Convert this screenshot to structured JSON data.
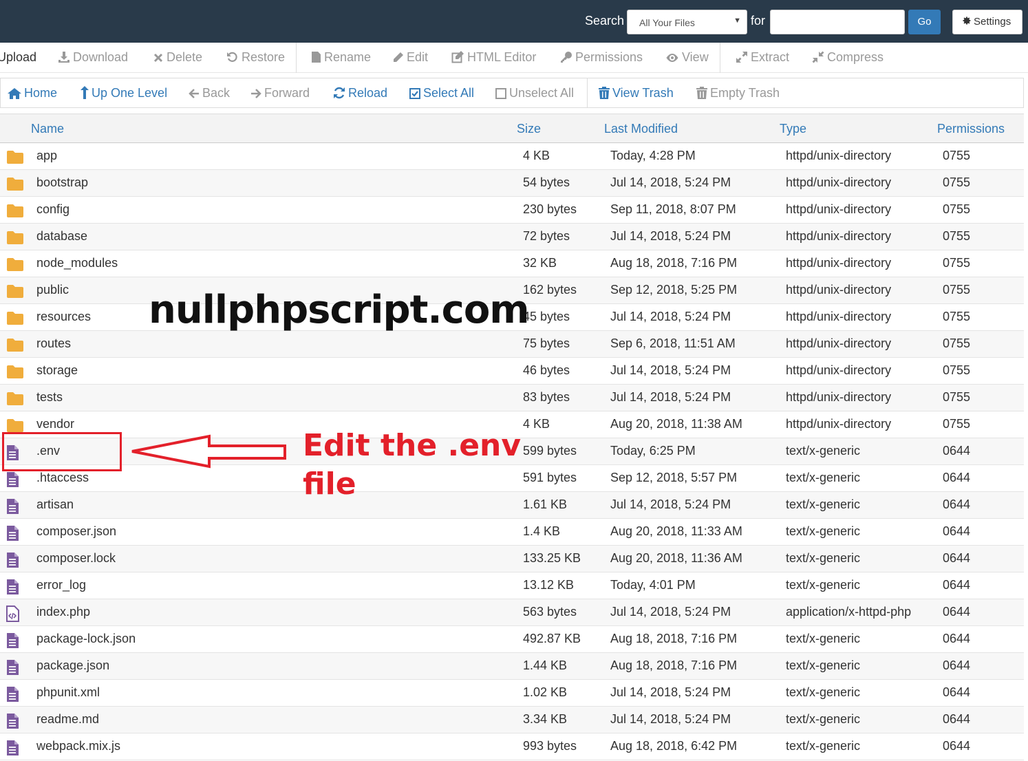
{
  "topbar": {
    "search_label": "Search",
    "scope_value": "All Your Files",
    "for_label": "for",
    "search_value": "",
    "go_label": "Go",
    "settings_label": "Settings"
  },
  "toolbar1": {
    "upload": "Upload",
    "download": "Download",
    "delete": "Delete",
    "restore": "Restore",
    "rename": "Rename",
    "edit": "Edit",
    "html_editor": "HTML Editor",
    "permissions": "Permissions",
    "view": "View",
    "extract": "Extract",
    "compress": "Compress"
  },
  "toolbar2": {
    "home": "Home",
    "up_one_level": "Up One Level",
    "back": "Back",
    "forward": "Forward",
    "reload": "Reload",
    "select_all": "Select All",
    "unselect_all": "Unselect All",
    "view_trash": "View Trash",
    "empty_trash": "Empty Trash"
  },
  "table": {
    "headers": {
      "name": "Name",
      "size": "Size",
      "last_modified": "Last Modified",
      "type": "Type",
      "permissions": "Permissions"
    },
    "rows": [
      {
        "icon": "folder-icon",
        "name": "app",
        "size": "4 KB",
        "modified": "Today, 4:28 PM",
        "type": "httpd/unix-directory",
        "perms": "0755"
      },
      {
        "icon": "folder-icon",
        "name": "bootstrap",
        "size": "54 bytes",
        "modified": "Jul 14, 2018, 5:24 PM",
        "type": "httpd/unix-directory",
        "perms": "0755"
      },
      {
        "icon": "folder-icon",
        "name": "config",
        "size": "230 bytes",
        "modified": "Sep 11, 2018, 8:07 PM",
        "type": "httpd/unix-directory",
        "perms": "0755"
      },
      {
        "icon": "folder-icon",
        "name": "database",
        "size": "72 bytes",
        "modified": "Jul 14, 2018, 5:24 PM",
        "type": "httpd/unix-directory",
        "perms": "0755"
      },
      {
        "icon": "folder-icon",
        "name": "node_modules",
        "size": "32 KB",
        "modified": "Aug 18, 2018, 7:16 PM",
        "type": "httpd/unix-directory",
        "perms": "0755"
      },
      {
        "icon": "folder-icon",
        "name": "public",
        "size": "162 bytes",
        "modified": "Sep 12, 2018, 5:25 PM",
        "type": "httpd/unix-directory",
        "perms": "0755"
      },
      {
        "icon": "folder-icon",
        "name": "resources",
        "size": "45 bytes",
        "modified": "Jul 14, 2018, 5:24 PM",
        "type": "httpd/unix-directory",
        "perms": "0755"
      },
      {
        "icon": "folder-icon",
        "name": "routes",
        "size": "75 bytes",
        "modified": "Sep 6, 2018, 11:51 AM",
        "type": "httpd/unix-directory",
        "perms": "0755"
      },
      {
        "icon": "folder-icon",
        "name": "storage",
        "size": "46 bytes",
        "modified": "Jul 14, 2018, 5:24 PM",
        "type": "httpd/unix-directory",
        "perms": "0755"
      },
      {
        "icon": "folder-icon",
        "name": "tests",
        "size": "83 bytes",
        "modified": "Jul 14, 2018, 5:24 PM",
        "type": "httpd/unix-directory",
        "perms": "0755"
      },
      {
        "icon": "folder-icon",
        "name": "vendor",
        "size": "4 KB",
        "modified": "Aug 20, 2018, 11:38 AM",
        "type": "httpd/unix-directory",
        "perms": "0755"
      },
      {
        "icon": "file-icon",
        "name": ".env",
        "size": "599 bytes",
        "modified": "Today, 6:25 PM",
        "type": "text/x-generic",
        "perms": "0644"
      },
      {
        "icon": "file-icon",
        "name": ".htaccess",
        "size": "591 bytes",
        "modified": "Sep 12, 2018, 5:57 PM",
        "type": "text/x-generic",
        "perms": "0644"
      },
      {
        "icon": "file-icon",
        "name": "artisan",
        "size": "1.61 KB",
        "modified": "Jul 14, 2018, 5:24 PM",
        "type": "text/x-generic",
        "perms": "0644"
      },
      {
        "icon": "file-icon",
        "name": "composer.json",
        "size": "1.4 KB",
        "modified": "Aug 20, 2018, 11:33 AM",
        "type": "text/x-generic",
        "perms": "0644"
      },
      {
        "icon": "file-icon",
        "name": "composer.lock",
        "size": "133.25 KB",
        "modified": "Aug 20, 2018, 11:36 AM",
        "type": "text/x-generic",
        "perms": "0644"
      },
      {
        "icon": "file-icon",
        "name": "error_log",
        "size": "13.12 KB",
        "modified": "Today, 4:01 PM",
        "type": "text/x-generic",
        "perms": "0644"
      },
      {
        "icon": "code-file-icon",
        "name": "index.php",
        "size": "563 bytes",
        "modified": "Jul 14, 2018, 5:24 PM",
        "type": "application/x-httpd-php",
        "perms": "0644"
      },
      {
        "icon": "file-icon",
        "name": "package-lock.json",
        "size": "492.87 KB",
        "modified": "Aug 18, 2018, 7:16 PM",
        "type": "text/x-generic",
        "perms": "0644"
      },
      {
        "icon": "file-icon",
        "name": "package.json",
        "size": "1.44 KB",
        "modified": "Aug 18, 2018, 7:16 PM",
        "type": "text/x-generic",
        "perms": "0644"
      },
      {
        "icon": "file-icon",
        "name": "phpunit.xml",
        "size": "1.02 KB",
        "modified": "Jul 14, 2018, 5:24 PM",
        "type": "text/x-generic",
        "perms": "0644"
      },
      {
        "icon": "file-icon",
        "name": "readme.md",
        "size": "3.34 KB",
        "modified": "Jul 14, 2018, 5:24 PM",
        "type": "text/x-generic",
        "perms": "0644"
      },
      {
        "icon": "file-icon",
        "name": "webpack.mix.js",
        "size": "993 bytes",
        "modified": "Aug 18, 2018, 6:42 PM",
        "type": "text/x-generic",
        "perms": "0644"
      }
    ]
  },
  "annotations": {
    "watermark": "nullphpscript.com",
    "callout_line1": "Edit the .env",
    "callout_line2": "file",
    "highlight_color": "#e3202a"
  },
  "colors": {
    "topbar_bg": "#293a4a",
    "link_blue": "#337ab7",
    "folder": "#f0ad3c",
    "file": "#7b5a9e"
  }
}
